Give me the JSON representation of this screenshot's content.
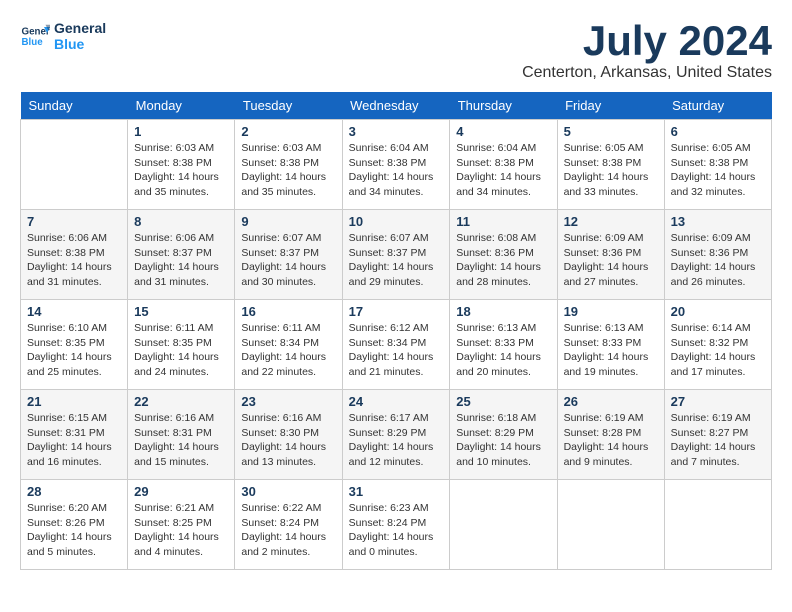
{
  "logo": {
    "line1": "General",
    "line2": "Blue"
  },
  "title": "July 2024",
  "location": "Centerton, Arkansas, United States",
  "days_of_week": [
    "Sunday",
    "Monday",
    "Tuesday",
    "Wednesday",
    "Thursday",
    "Friday",
    "Saturday"
  ],
  "weeks": [
    [
      {
        "day": "",
        "info": ""
      },
      {
        "day": "1",
        "info": "Sunrise: 6:03 AM\nSunset: 8:38 PM\nDaylight: 14 hours\nand 35 minutes."
      },
      {
        "day": "2",
        "info": "Sunrise: 6:03 AM\nSunset: 8:38 PM\nDaylight: 14 hours\nand 35 minutes."
      },
      {
        "day": "3",
        "info": "Sunrise: 6:04 AM\nSunset: 8:38 PM\nDaylight: 14 hours\nand 34 minutes."
      },
      {
        "day": "4",
        "info": "Sunrise: 6:04 AM\nSunset: 8:38 PM\nDaylight: 14 hours\nand 34 minutes."
      },
      {
        "day": "5",
        "info": "Sunrise: 6:05 AM\nSunset: 8:38 PM\nDaylight: 14 hours\nand 33 minutes."
      },
      {
        "day": "6",
        "info": "Sunrise: 6:05 AM\nSunset: 8:38 PM\nDaylight: 14 hours\nand 32 minutes."
      }
    ],
    [
      {
        "day": "7",
        "info": "Sunrise: 6:06 AM\nSunset: 8:38 PM\nDaylight: 14 hours\nand 31 minutes."
      },
      {
        "day": "8",
        "info": "Sunrise: 6:06 AM\nSunset: 8:37 PM\nDaylight: 14 hours\nand 31 minutes."
      },
      {
        "day": "9",
        "info": "Sunrise: 6:07 AM\nSunset: 8:37 PM\nDaylight: 14 hours\nand 30 minutes."
      },
      {
        "day": "10",
        "info": "Sunrise: 6:07 AM\nSunset: 8:37 PM\nDaylight: 14 hours\nand 29 minutes."
      },
      {
        "day": "11",
        "info": "Sunrise: 6:08 AM\nSunset: 8:36 PM\nDaylight: 14 hours\nand 28 minutes."
      },
      {
        "day": "12",
        "info": "Sunrise: 6:09 AM\nSunset: 8:36 PM\nDaylight: 14 hours\nand 27 minutes."
      },
      {
        "day": "13",
        "info": "Sunrise: 6:09 AM\nSunset: 8:36 PM\nDaylight: 14 hours\nand 26 minutes."
      }
    ],
    [
      {
        "day": "14",
        "info": "Sunrise: 6:10 AM\nSunset: 8:35 PM\nDaylight: 14 hours\nand 25 minutes."
      },
      {
        "day": "15",
        "info": "Sunrise: 6:11 AM\nSunset: 8:35 PM\nDaylight: 14 hours\nand 24 minutes."
      },
      {
        "day": "16",
        "info": "Sunrise: 6:11 AM\nSunset: 8:34 PM\nDaylight: 14 hours\nand 22 minutes."
      },
      {
        "day": "17",
        "info": "Sunrise: 6:12 AM\nSunset: 8:34 PM\nDaylight: 14 hours\nand 21 minutes."
      },
      {
        "day": "18",
        "info": "Sunrise: 6:13 AM\nSunset: 8:33 PM\nDaylight: 14 hours\nand 20 minutes."
      },
      {
        "day": "19",
        "info": "Sunrise: 6:13 AM\nSunset: 8:33 PM\nDaylight: 14 hours\nand 19 minutes."
      },
      {
        "day": "20",
        "info": "Sunrise: 6:14 AM\nSunset: 8:32 PM\nDaylight: 14 hours\nand 17 minutes."
      }
    ],
    [
      {
        "day": "21",
        "info": "Sunrise: 6:15 AM\nSunset: 8:31 PM\nDaylight: 14 hours\nand 16 minutes."
      },
      {
        "day": "22",
        "info": "Sunrise: 6:16 AM\nSunset: 8:31 PM\nDaylight: 14 hours\nand 15 minutes."
      },
      {
        "day": "23",
        "info": "Sunrise: 6:16 AM\nSunset: 8:30 PM\nDaylight: 14 hours\nand 13 minutes."
      },
      {
        "day": "24",
        "info": "Sunrise: 6:17 AM\nSunset: 8:29 PM\nDaylight: 14 hours\nand 12 minutes."
      },
      {
        "day": "25",
        "info": "Sunrise: 6:18 AM\nSunset: 8:29 PM\nDaylight: 14 hours\nand 10 minutes."
      },
      {
        "day": "26",
        "info": "Sunrise: 6:19 AM\nSunset: 8:28 PM\nDaylight: 14 hours\nand 9 minutes."
      },
      {
        "day": "27",
        "info": "Sunrise: 6:19 AM\nSunset: 8:27 PM\nDaylight: 14 hours\nand 7 minutes."
      }
    ],
    [
      {
        "day": "28",
        "info": "Sunrise: 6:20 AM\nSunset: 8:26 PM\nDaylight: 14 hours\nand 5 minutes."
      },
      {
        "day": "29",
        "info": "Sunrise: 6:21 AM\nSunset: 8:25 PM\nDaylight: 14 hours\nand 4 minutes."
      },
      {
        "day": "30",
        "info": "Sunrise: 6:22 AM\nSunset: 8:24 PM\nDaylight: 14 hours\nand 2 minutes."
      },
      {
        "day": "31",
        "info": "Sunrise: 6:23 AM\nSunset: 8:24 PM\nDaylight: 14 hours\nand 0 minutes."
      },
      {
        "day": "",
        "info": ""
      },
      {
        "day": "",
        "info": ""
      },
      {
        "day": "",
        "info": ""
      }
    ]
  ]
}
